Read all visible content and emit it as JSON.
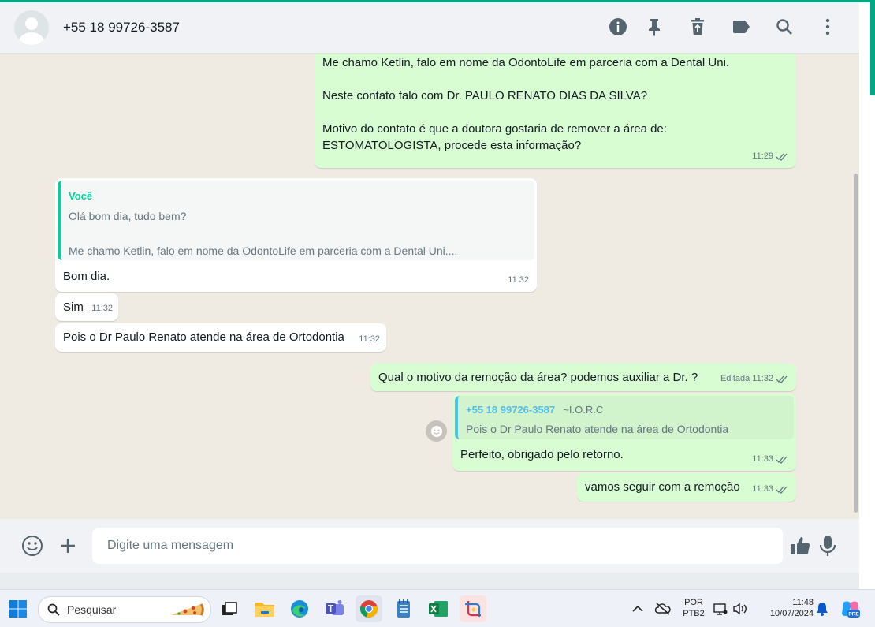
{
  "header": {
    "contact": "+55 18 99726-3587",
    "icons": [
      "info-icon",
      "pin-icon",
      "delete-icon",
      "label-icon",
      "search-icon",
      "menu-icon"
    ]
  },
  "messages": {
    "m1": {
      "line1": "Me chamo Ketlin, falo em nome da OdontoLife em parceria com a Dental Uni.",
      "line2": "Neste contato falo com Dr. PAULO RENATO DIAS DA SILVA?",
      "line3": "Motivo do contato é que a doutora gostaria de remover a área de:",
      "line4": "ESTOMATOLOGISTA, procede esta informação?",
      "time": "11:29"
    },
    "m2": {
      "quote_author": "Você",
      "quote_line1": "Olá bom dia, tudo bem?",
      "quote_line2": "Me chamo Ketlin, falo em nome da OdontoLife em parceria com a Dental Uni....",
      "text": "Bom dia.",
      "time": "11:32"
    },
    "m3": {
      "text": "Sim",
      "time": "11:32"
    },
    "m4": {
      "text": "Pois o Dr Paulo Renato atende na área de Ortodontia",
      "time": "11:32"
    },
    "m5": {
      "text": "Qual o motivo da remoção da área? podemos auxiliar a Dr. ?",
      "edited": "Editada",
      "time": "11:32"
    },
    "m6": {
      "quote_author": "+55 18 99726-3587",
      "quote_alias": "~I.O.R.C",
      "quote_text": "Pois o Dr Paulo Renato atende na área de Ortodontia",
      "text": "Perfeito, obrigado pelo retorno.",
      "time": "11:33"
    },
    "m7": {
      "text": "vamos seguir com a remoção",
      "time": "11:33"
    }
  },
  "composer": {
    "placeholder": "Digite uma mensagem"
  },
  "taskbar": {
    "search_label": "Pesquisar",
    "lang1": "POR",
    "lang2": "PTB2",
    "clock_time": "11:48",
    "clock_date": "10/07/2024",
    "copilot_badge": "PRE"
  },
  "colors": {
    "accent": "#00a884",
    "outgoing": "#d9fdd3",
    "incoming": "#ffffff",
    "chat_bg": "#efeae2",
    "tick": "#667781"
  }
}
